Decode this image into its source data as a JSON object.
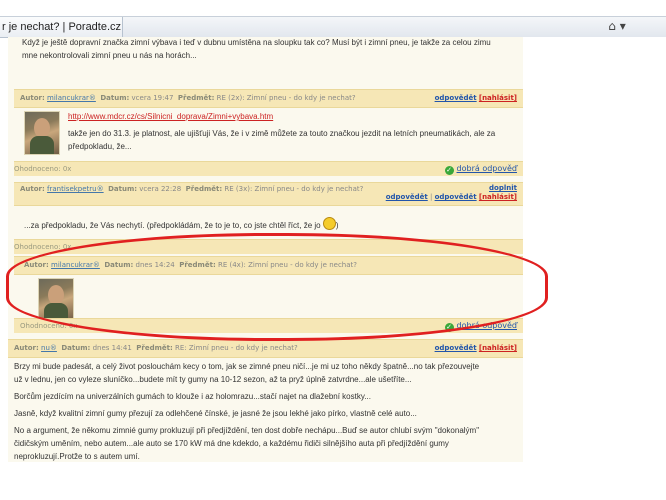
{
  "browser": {
    "tab_title": "r je nechat? | Poradte.cz",
    "home_icon": "home-icon"
  },
  "posts": {
    "p0": {
      "text_line1": "Když je ještě dopravní značka zimní výbava i teď v dubnu umístěna na sloupku tak co? Musí být i zimní pneu, je takže za celou zimu",
      "text_line2": "mne nekontrolovali zimní pneu u nás na horách..."
    },
    "p1": {
      "author_label": "Autor:",
      "author": "milancukrar®",
      "date_label": "Datum:",
      "date": "vcera 19:47",
      "subject_label": "Předmět:",
      "subject": "RE (2x): Zimní pneu - do kdy je nechat?",
      "reply": "odpovědět",
      "report": "[nahlásit]",
      "link": "http://www.mdcr.cz/cs/Silnicni_doprava/Zimni+vybava.htm",
      "text_line1": "takže jen do 31.3. je platnost, ale ujišťuji Vás, že i v zimě můžete za touto značkou jezdit na letních pneumatikách, ale za",
      "text_line2": "předpokladu, že...",
      "rating": "Ohodnoceno: 0x",
      "good_answer": "dobrá odpověď"
    },
    "p2": {
      "author_label": "Autor:",
      "author": "frantisekpetru®",
      "date_label": "Datum:",
      "date": "vcera 22:28",
      "subject_label": "Předmět:",
      "subject": "RE (3x): Zimní pneu - do kdy je nechat?",
      "complete": "doplnit",
      "reply": "odpovědět",
      "report": "[nahlásit]",
      "text": "...za předpokladu, že Vás nechytí. (předpokládám, že to je to, co jste chtěl říct, že jo",
      "text_end": ")",
      "rating": "Ohodnoceno: 0x"
    },
    "p3": {
      "author_label": "Autor:",
      "author": "milancukrar®",
      "date_label": "Datum:",
      "date": "dnes 14:24",
      "subject_label": "Předmět:",
      "subject": "RE (4x): Zimní pneu - do kdy je nechat?",
      "rating": "Ohodnoceno: 0x",
      "good_answer": "dobrá odpověď"
    },
    "p4": {
      "author_label": "Autor:",
      "author": "nu®",
      "date_label": "Datum:",
      "date": "dnes 14:41",
      "subject_label": "Předmět:",
      "subject": "RE: Zimní pneu - do kdy je nechat?",
      "reply": "odpovědět",
      "report": "[nahlásit]",
      "para1_line1": "Brzy mi bude padesát, a celý život poslouchám kecy o tom, jak se zimné pneu ničí...je mi uz toho někdy špatně...no tak přezouvejte",
      "para1_line2": "už v lednu, jen co vyleze sluníčko...budete mít ty gumy na 10-12 sezon, až ta pryž úplně zatvrdne...ale ušetříte...",
      "para2": "Borčům jezdícím na univerzálních gumách to klouže i az holomrazu...stačí najet na dlažební kostky...",
      "para3": "Jasně, když kvalitní zimní gumy přezují za odlehčené čínské, je jasné že jsou lekhé jako pírko, vlastně celé auto...",
      "para4_line1": "No a argument, že někomu zimnié gumy prokluzují při předjíždění, ten dost dobře nechápu...Buď se autor chlubí svým \"dokonalým\"",
      "para4_line2": "čidičským uměním, nebo autem...ale auto se 170 kW má dne kdekdo, a každému řidiči silnějšího auta při předjíždění gumy",
      "para4_line3": "neprokluzují.Protže to s autem umí."
    }
  },
  "colors": {
    "header_bg": "#f6e7b6",
    "page_bg": "#fbf9ee",
    "highlight_oval": "#e02020",
    "link_red": "#cc2222",
    "link_blue": "#2255aa"
  }
}
